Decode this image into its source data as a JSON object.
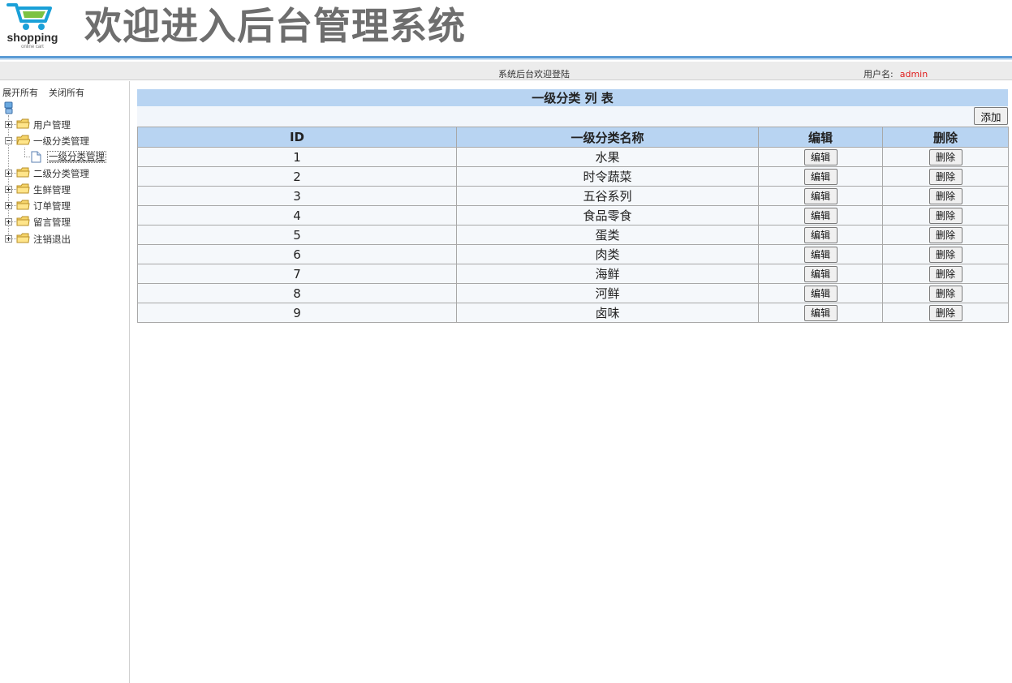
{
  "header": {
    "logo_text": "shopping",
    "logo_subtext": "online cart",
    "title": "欢迎进入后台管理系统"
  },
  "statusbar": {
    "welcome": "系统后台欢迎登陆",
    "user_label": "用户名:",
    "username": "admin",
    "username_color": "#e02020"
  },
  "sidebar": {
    "expand_all": "展开所有",
    "collapse_all": "关闭所有",
    "items": [
      {
        "label": "用户管理",
        "expanded": false
      },
      {
        "label": "一级分类管理",
        "expanded": true
      },
      {
        "label": "二级分类管理",
        "expanded": false
      },
      {
        "label": "生鲜管理",
        "expanded": false
      },
      {
        "label": "订单管理",
        "expanded": false
      },
      {
        "label": "留言管理",
        "expanded": false
      },
      {
        "label": "注销退出",
        "expanded": false
      }
    ],
    "active_leaf": "一级分类管理"
  },
  "main": {
    "list_title": "一级分类 列 表",
    "add_label": "添加",
    "columns": [
      "ID",
      "一级分类名称",
      "编辑",
      "删除"
    ],
    "edit_label": "编辑",
    "delete_label": "删除",
    "rows": [
      {
        "id": "1",
        "name": "水果"
      },
      {
        "id": "2",
        "name": "时令蔬菜"
      },
      {
        "id": "3",
        "name": "五谷系列"
      },
      {
        "id": "4",
        "name": "食品零食"
      },
      {
        "id": "5",
        "name": "蛋类"
      },
      {
        "id": "6",
        "name": "肉类"
      },
      {
        "id": "7",
        "name": "海鲜"
      },
      {
        "id": "8",
        "name": "河鲜"
      },
      {
        "id": "9",
        "name": "卤味"
      }
    ]
  },
  "colors": {
    "header_accent": "#5b9bd5",
    "table_header_bg": "#b8d4f2",
    "row_bg": "#f5f8fb",
    "title_gray": "#6e6e6e"
  }
}
